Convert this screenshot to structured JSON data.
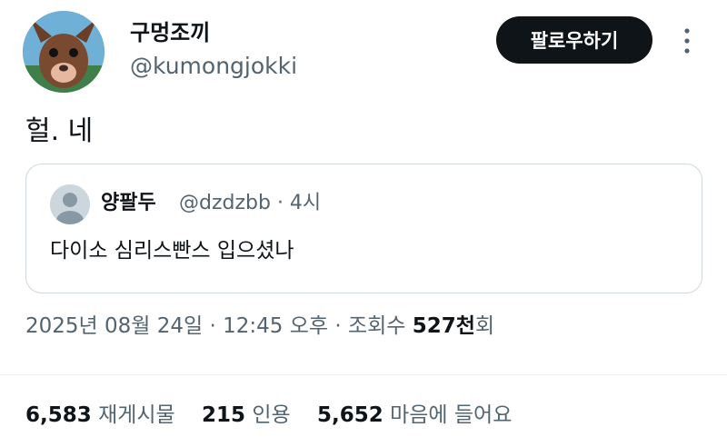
{
  "author": {
    "display_name": "구멍조끼",
    "handle": "@kumongjokki"
  },
  "follow_label": "팔로우하기",
  "tweet_text": "헐. 네",
  "quoted": {
    "name": "양팔두",
    "handle": "@dzdzbb · 4시",
    "text": "다이소 심리스빤스 입으셨나"
  },
  "meta": {
    "date": "2025년 08월 24일",
    "time": "12:45 오후",
    "views_label": "조회수",
    "views_count": "527천",
    "views_suffix": "회",
    "sep": "·"
  },
  "stats": [
    {
      "count": "6,583",
      "label": "재게시물"
    },
    {
      "count": "215",
      "label": "인용"
    },
    {
      "count": "5,652",
      "label": "마음에 들어요"
    }
  ],
  "icons": {
    "avatar": "chihuahua-avatar",
    "quoted_avatar": "default-user-icon",
    "more": "more-vertical-icon"
  }
}
